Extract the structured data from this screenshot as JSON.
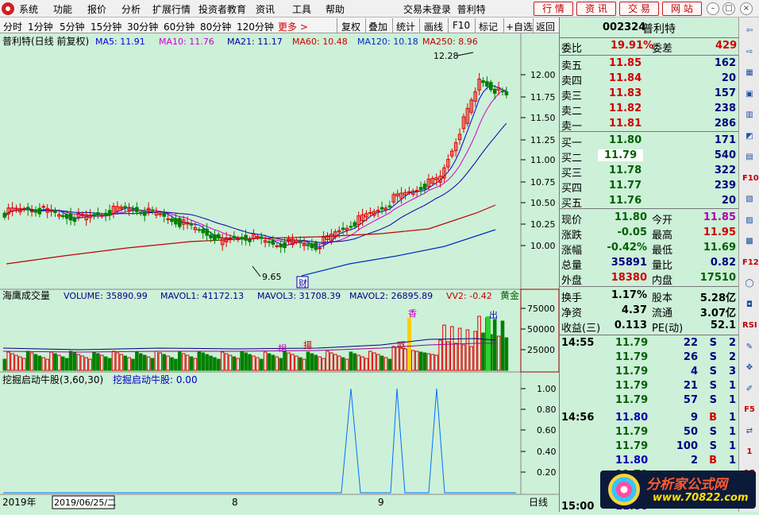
{
  "menu": {
    "items": [
      "系统",
      "功能",
      "报价",
      "分析",
      "扩展行情",
      "投资者教育",
      "资讯",
      "工具",
      "帮助"
    ],
    "status": "交易未登录",
    "stock": "普利特",
    "buttons": [
      "行 情",
      "资 讯",
      "交 易",
      "网 站"
    ]
  },
  "toolbar": {
    "periods": [
      "分时",
      "1分钟",
      "5分钟",
      "15分钟",
      "30分钟",
      "60分钟",
      "80分钟",
      "120分钟"
    ],
    "more": "更多 >",
    "buttons": [
      "复权",
      "叠加",
      "统计",
      "画线",
      "F10",
      "标记",
      "+自选",
      "返回"
    ]
  },
  "kline": {
    "title": "普利特(日线 前复权)",
    "ma": [
      {
        "label": "MA5: 11.91",
        "color": "#0000e0"
      },
      {
        "label": "MA10: 11.76",
        "color": "#d000d0"
      },
      {
        "label": "MA21: 11.17",
        "color": "#0000a0"
      },
      {
        "label": "MA60: 10.48",
        "color": "#d00000"
      },
      {
        "label": "MA120: 10.18",
        "color": "#0030c0"
      },
      {
        "label": "MA250: 8.96",
        "color": "#c00000"
      }
    ],
    "high_label": "12.28",
    "low_label": "9.65",
    "y_ticks": [
      "12.00",
      "11.75",
      "11.50",
      "11.25",
      "11.00",
      "10.75",
      "10.50",
      "10.25",
      "10.00"
    ],
    "marker_cai": "财",
    "up_color": "#e00000",
    "down_color": "#008000"
  },
  "volume": {
    "title": "海鹰成交量",
    "items": [
      {
        "label": "VOLUME: 35890.99",
        "color": "#000080"
      },
      {
        "label": "MAVOL1: 41172.13",
        "color": "#000080"
      },
      {
        "label": "MAVOL3: 31708.39",
        "color": "#000080"
      },
      {
        "label": "MAVOL2: 26895.89",
        "color": "#000080"
      },
      {
        "label": "VV2: -0.42",
        "color": "#c00000"
      }
    ],
    "gold": "黄金",
    "y_ticks": [
      "75000",
      "50000",
      "25000"
    ],
    "markers": [
      "相",
      "呕",
      "揚",
      "香",
      "出"
    ]
  },
  "indicator": {
    "title": "挖掘启动牛股(3,60,30)",
    "value_label": "挖掘启动牛股: 0.00",
    "y_ticks": [
      "1.00",
      "0.80",
      "0.60",
      "0.40",
      "0.20"
    ]
  },
  "timeline": {
    "year": "2019年",
    "date": "2019/06/25/二",
    "month8": "8",
    "month9": "9",
    "mode": "日线"
  },
  "quote": {
    "code": "002324",
    "name": "普利特",
    "weibi_label": "委比",
    "weibi": "19.91%",
    "weicha_label": "委差",
    "weicha": "429",
    "asks": [
      {
        "label": "卖五",
        "price": "11.85",
        "vol": "162"
      },
      {
        "label": "卖四",
        "price": "11.84",
        "vol": "20"
      },
      {
        "label": "卖三",
        "price": "11.83",
        "vol": "157"
      },
      {
        "label": "卖二",
        "price": "11.82",
        "vol": "238"
      },
      {
        "label": "卖一",
        "price": "11.81",
        "vol": "286"
      }
    ],
    "bids": [
      {
        "label": "买一",
        "price": "11.80",
        "vol": "171"
      },
      {
        "label": "买二",
        "price": "11.79",
        "vol": "540"
      },
      {
        "label": "买三",
        "price": "11.78",
        "vol": "322"
      },
      {
        "label": "买四",
        "price": "11.77",
        "vol": "239"
      },
      {
        "label": "买五",
        "price": "11.76",
        "vol": "20"
      }
    ],
    "stats": [
      {
        "l1": "现价",
        "v1": "11.80",
        "c1": "green",
        "l2": "今开",
        "v2": "11.85",
        "c2": "mag"
      },
      {
        "l1": "涨跌",
        "v1": "-0.05",
        "c1": "green",
        "l2": "最高",
        "v2": "11.95",
        "c2": "red"
      },
      {
        "l1": "涨幅",
        "v1": "-0.42%",
        "c1": "green",
        "l2": "最低",
        "v2": "11.69",
        "c2": "green"
      },
      {
        "l1": "总量",
        "v1": "35891",
        "c1": "navy",
        "l2": "量比",
        "v2": "0.82",
        "c2": "navy"
      },
      {
        "l1": "外盘",
        "v1": "18380",
        "c1": "red",
        "l2": "内盘",
        "v2": "17510",
        "c2": "green"
      }
    ],
    "fin": [
      {
        "l1": "换手",
        "v1": "1.17%",
        "l2": "股本",
        "v2": "5.28亿"
      },
      {
        "l1": "净资",
        "v1": "4.37",
        "l2": "流通",
        "v2": "3.07亿"
      },
      {
        "l1": "收益(三)",
        "v1": "0.113",
        "l2": "PE(动)",
        "v2": "52.1"
      }
    ],
    "ticks": [
      {
        "time": "14:55",
        "price": "11.79",
        "vol": "22",
        "side": "S",
        "n": "2"
      },
      {
        "time": "",
        "price": "11.79",
        "vol": "26",
        "side": "S",
        "n": "2"
      },
      {
        "time": "",
        "price": "11.79",
        "vol": "4",
        "side": "S",
        "n": "3"
      },
      {
        "time": "",
        "price": "11.79",
        "vol": "21",
        "side": "S",
        "n": "1"
      },
      {
        "time": "",
        "price": "11.79",
        "vol": "57",
        "side": "S",
        "n": "1"
      },
      {
        "time": "14:56",
        "price": "11.80",
        "vol": "9",
        "side": "B",
        "n": "1"
      },
      {
        "time": "",
        "price": "11.79",
        "vol": "50",
        "side": "S",
        "n": "1"
      },
      {
        "time": "",
        "price": "11.79",
        "vol": "100",
        "side": "S",
        "n": "1"
      },
      {
        "time": "",
        "price": "11.80",
        "vol": "2",
        "side": "B",
        "n": "1"
      },
      {
        "time": "",
        "price": "11.79",
        "vol": "",
        "side": "",
        "n": ""
      },
      {
        "time": "",
        "price": "11.79",
        "vol": "",
        "side": "",
        "n": ""
      },
      {
        "time": "15:00",
        "price": "11.80",
        "vol": "",
        "side": "",
        "n": ""
      }
    ]
  },
  "side_icons": [
    "arrow-left-icon",
    "arrow-right-icon",
    "grid-icon",
    "window-icon",
    "kline-icon",
    "chart-icon",
    "kline2-icon",
    "f10-icon",
    "calc-icon",
    "zone-icon",
    "info-icon",
    "f12-icon",
    "circle-icon",
    "letter-icon",
    "rsi-icon",
    "brush-icon",
    "move-icon",
    "pen-icon",
    "f5-icon",
    "swap-icon",
    "one-icon",
    "fifteen-icon"
  ],
  "side_labels": [
    "",
    "",
    "",
    "",
    "",
    "",
    "",
    "F10",
    "",
    "",
    "",
    "F12",
    "",
    "",
    "RSI",
    "",
    "",
    "",
    "F5",
    "",
    "1",
    "15"
  ],
  "watermark": {
    "line1": "分析家公式网",
    "line2": "www.70822.com"
  }
}
